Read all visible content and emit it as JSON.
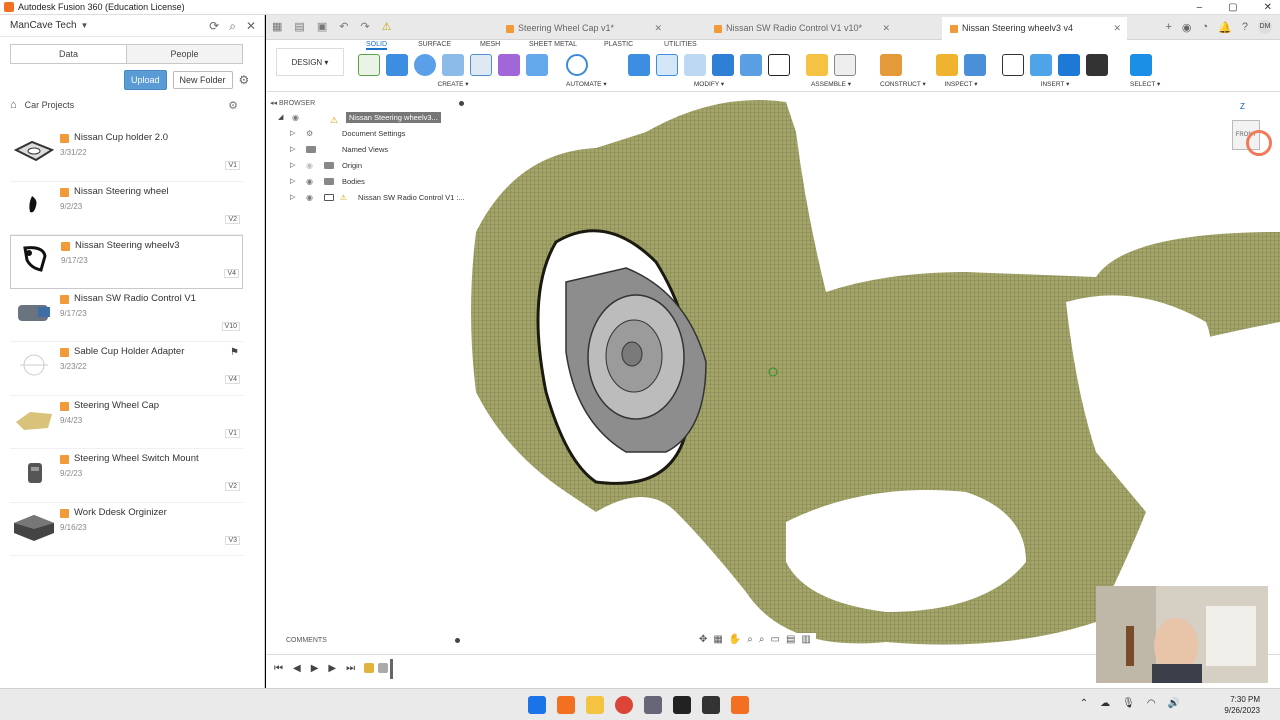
{
  "window": {
    "title": "Autodesk Fusion 360 (Education License)"
  },
  "data_panel": {
    "team": "ManCave Tech",
    "tabs": [
      "Data",
      "People"
    ],
    "upload_label": "Upload",
    "new_folder_label": "New Folder",
    "breadcrumb": "Car Projects",
    "files": [
      {
        "name": "Nissan Cup holder 2.0",
        "date": "3/31/22",
        "version": "V1"
      },
      {
        "name": "Nissan Steering wheel",
        "date": "9/2/23",
        "version": "V2"
      },
      {
        "name": "Nissan Steering wheelv3",
        "date": "9/17/23",
        "version": "V4"
      },
      {
        "name": "Nissan SW Radio Control V1",
        "date": "9/17/23",
        "version": "V10"
      },
      {
        "name": "Sable Cup Holder Adapter",
        "date": "3/23/22",
        "version": "V4"
      },
      {
        "name": "Steering Wheel Cap",
        "date": "9/4/23",
        "version": "V1"
      },
      {
        "name": "Steering Wheel Switch Mount",
        "date": "9/2/23",
        "version": "V2"
      },
      {
        "name": "Work Ddesk Orginizer",
        "date": "9/16/23",
        "version": "V3"
      }
    ]
  },
  "doc_tabs": [
    {
      "label": "Steering Wheel Cap v1*"
    },
    {
      "label": "Nissan SW Radio Control V1 v10*"
    },
    {
      "label": "Nissan Steering wheelv3 v4"
    }
  ],
  "toolbar": {
    "workspace": "DESIGN",
    "tabs": [
      "SOLID",
      "SURFACE",
      "MESH",
      "SHEET METAL",
      "PLASTIC",
      "UTILITIES"
    ],
    "groups": [
      "CREATE",
      "AUTOMATE",
      "MODIFY",
      "ASSEMBLE",
      "CONSTRUCT",
      "INSPECT",
      "INSERT",
      "SELECT"
    ]
  },
  "browser": {
    "header": "BROWSER",
    "root": "Nissan Steering wheelv3...",
    "items": [
      "Document Settings",
      "Named Views",
      "Origin",
      "Bodies",
      "Nissan SW Radio Control V1 :..."
    ]
  },
  "viewcube": {
    "axis": "Z",
    "face": "FRONT"
  },
  "comments": "COMMENTS",
  "clock": {
    "time": "7:30 PM",
    "date": "9/26/2023"
  },
  "colors": {
    "mesh": "#9a9a5e",
    "accent": "#1b74c8",
    "brand": "#f36f21"
  }
}
